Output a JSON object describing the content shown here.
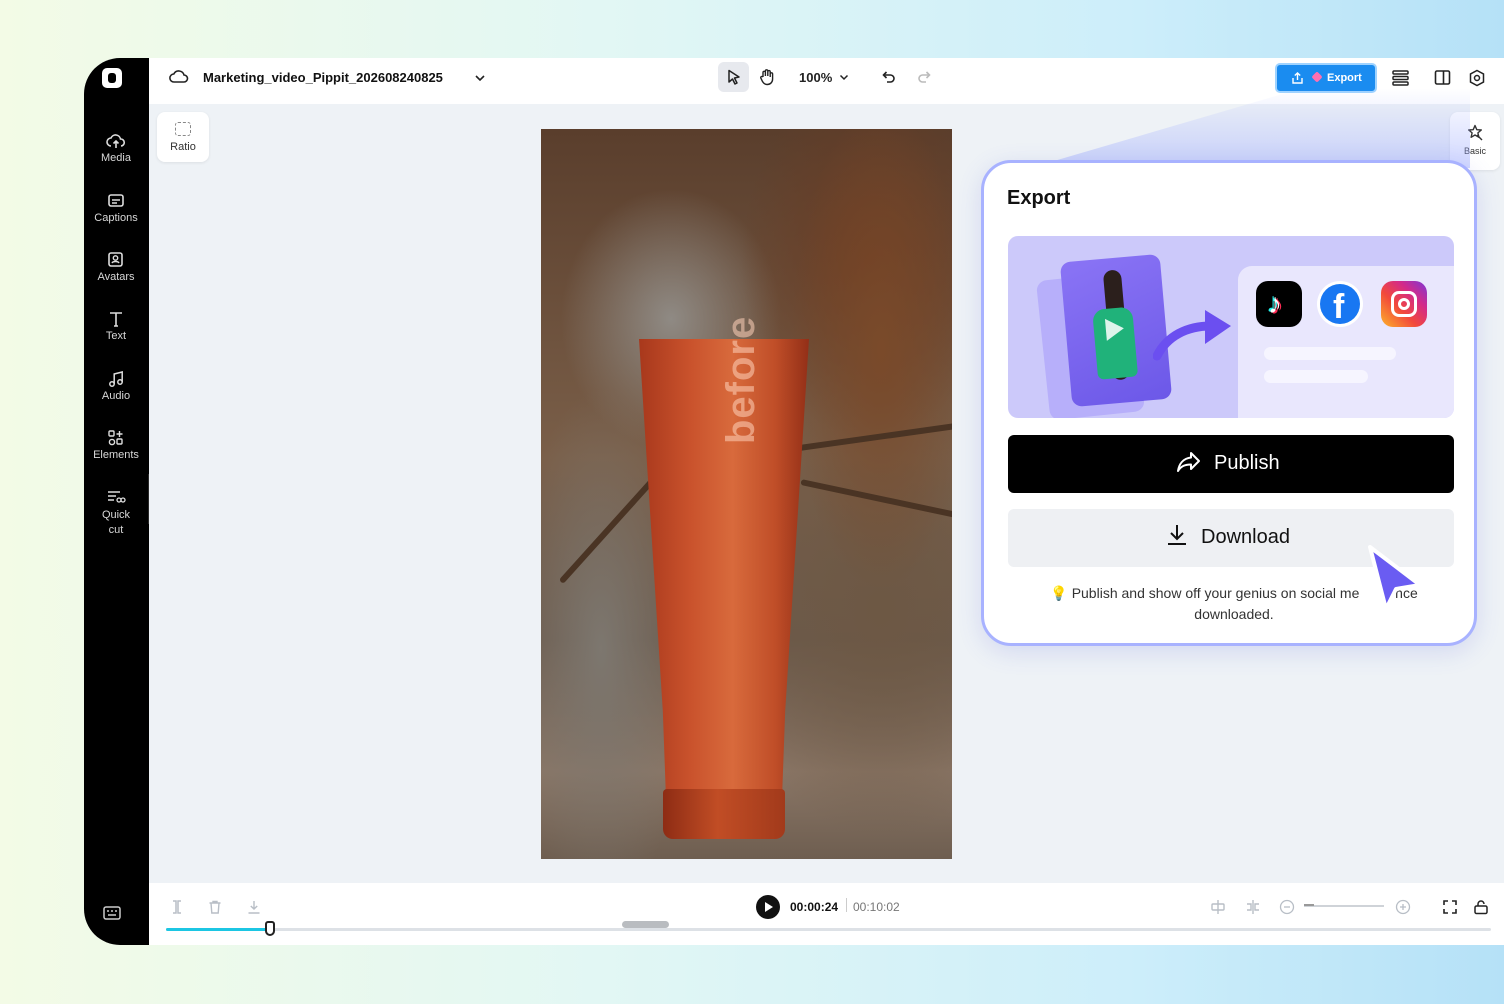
{
  "project": {
    "title": "Marketing_video_Pippit_202608240825"
  },
  "sidebar": {
    "items": [
      {
        "label": "Media",
        "icon": "cloud-upload-icon"
      },
      {
        "label": "Captions",
        "icon": "captions-icon"
      },
      {
        "label": "Avatars",
        "icon": "avatar-icon"
      },
      {
        "label": "Text",
        "icon": "text-icon"
      },
      {
        "label": "Audio",
        "icon": "music-note-icon"
      },
      {
        "label": "Elements",
        "icon": "elements-icon"
      },
      {
        "label": "Quick",
        "label2": "cut",
        "icon": "quick-cut-icon"
      }
    ]
  },
  "toolbar": {
    "zoom": "100%",
    "export_label": "Export"
  },
  "canvas": {
    "ratio_label": "Ratio",
    "basic_label": "Basic"
  },
  "video": {
    "tube_text": "before"
  },
  "timeline": {
    "current_time": "00:00:24",
    "total_time": "00:10:02",
    "progress_fraction": 0.08
  },
  "export_popup": {
    "title": "Export",
    "publish_label": "Publish",
    "download_label": "Download",
    "hint": "Publish and show off your genius on social me",
    "hint_tail": "once",
    "hint_line2": "downloaded.",
    "socials": [
      "tiktok-icon",
      "facebook-icon",
      "instagram-icon"
    ]
  },
  "colors": {
    "accent": "#1a8cf0",
    "popup_border": "#a8b2ff",
    "scrubber": "#1cc6e3"
  }
}
